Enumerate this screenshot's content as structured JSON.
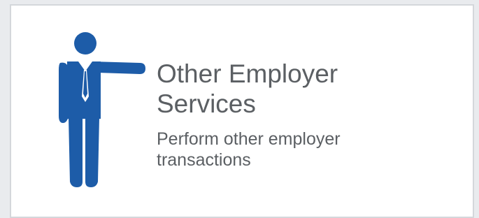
{
  "tile": {
    "title": "Other Employer\nServices",
    "description": "Perform other employer\ntransactions",
    "icon": "person-pointing-icon",
    "icon_color": "#1d5ca8",
    "text_color": "#5b5f63"
  }
}
